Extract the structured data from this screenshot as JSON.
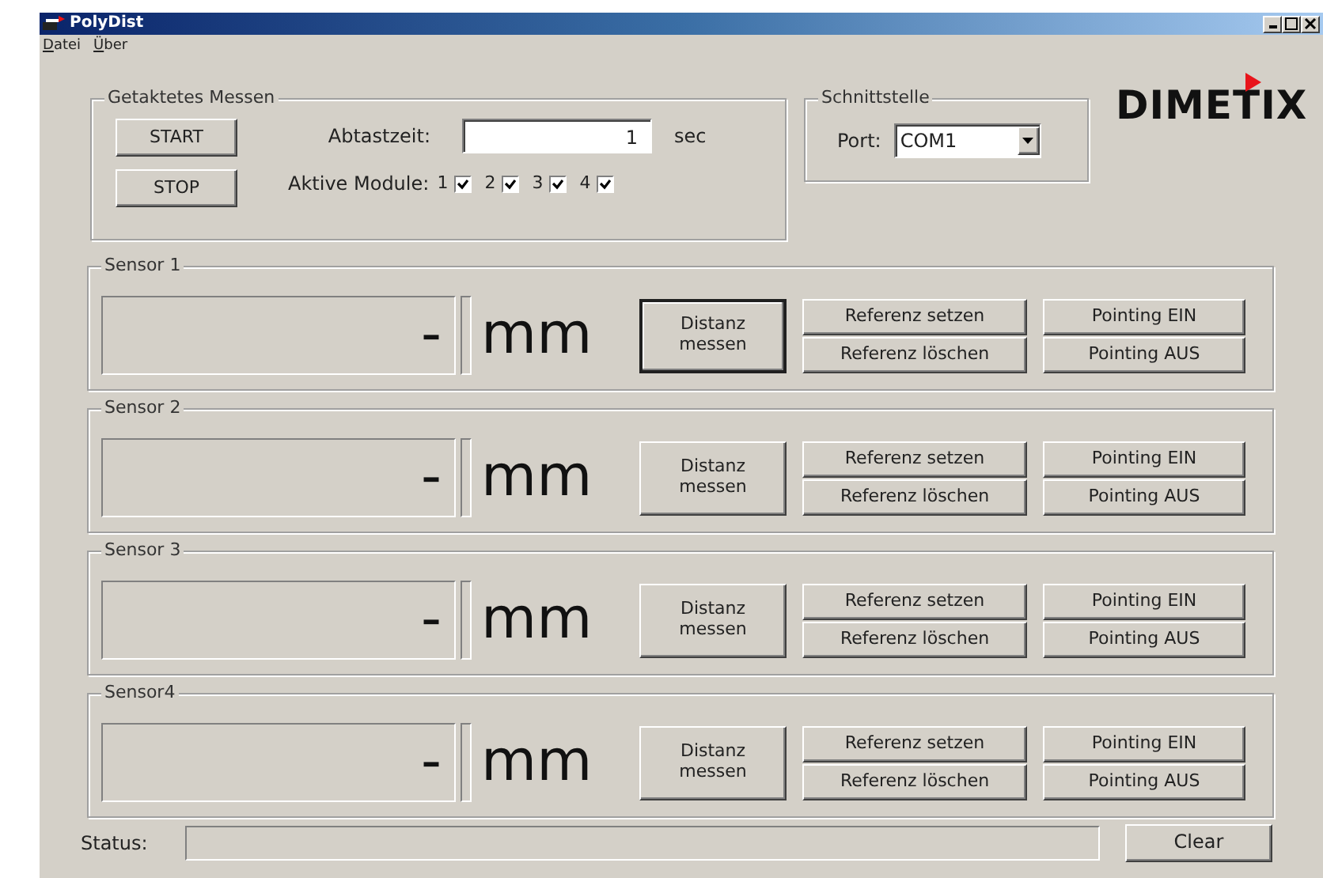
{
  "window": {
    "title": "PolyDist"
  },
  "menu": [
    {
      "label": "Datei",
      "underline_first": true
    },
    {
      "label": "Über",
      "underline_first": true
    }
  ],
  "timed": {
    "title": "Getaktetes Messen",
    "start_button": "START",
    "stop_button": "STOP",
    "interval_label": "Abtastzeit:",
    "interval_value": "1",
    "interval_unit": "sec",
    "modules_label": "Aktive Module:",
    "modules": [
      {
        "label": "1",
        "checked": true
      },
      {
        "label": "2",
        "checked": true
      },
      {
        "label": "3",
        "checked": true
      },
      {
        "label": "4",
        "checked": true
      }
    ]
  },
  "interface": {
    "title": "Schnittstelle",
    "port_label": "Port:",
    "port_value": "COM1"
  },
  "logo": {
    "text": "DIMETIX"
  },
  "sensors": [
    {
      "title": "Sensor 1",
      "value": "-",
      "unit": "mm",
      "measure_button": "Distanz messen",
      "focused": true,
      "ref_set": "Referenz setzen",
      "ref_clear": "Referenz löschen",
      "point_on": "Pointing EIN",
      "point_off": "Pointing AUS"
    },
    {
      "title": "Sensor 2",
      "value": "-",
      "unit": "mm",
      "measure_button": "Distanz messen",
      "focused": false,
      "ref_set": "Referenz setzen",
      "ref_clear": "Referenz löschen",
      "point_on": "Pointing EIN",
      "point_off": "Pointing AUS"
    },
    {
      "title": "Sensor 3",
      "value": "-",
      "unit": "mm",
      "measure_button": "Distanz messen",
      "focused": false,
      "ref_set": "Referenz setzen",
      "ref_clear": "Referenz löschen",
      "point_on": "Pointing EIN",
      "point_off": "Pointing AUS"
    },
    {
      "title": "Sensor4",
      "value": "-",
      "unit": "mm",
      "measure_button": "Distanz messen",
      "focused": false,
      "ref_set": "Referenz setzen",
      "ref_clear": "Referenz löschen",
      "point_on": "Pointing EIN",
      "point_off": "Pointing AUS"
    }
  ],
  "status": {
    "label": "Status:",
    "clear_button": "Clear"
  }
}
